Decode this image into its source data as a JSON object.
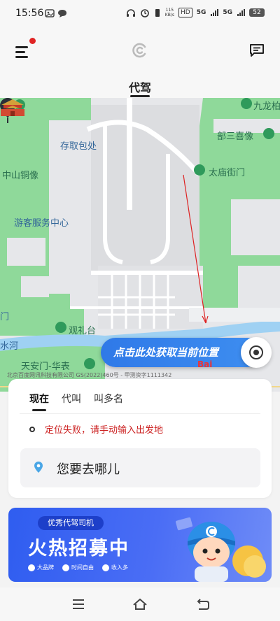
{
  "status_bar": {
    "time": "15:56",
    "net_speed_value": "115",
    "net_speed_unit": "KB/s",
    "hd_label": "HD",
    "signal1": "5G",
    "signal2": "5G",
    "battery": "52"
  },
  "header": {
    "tab_title": "代驾",
    "has_notification": true
  },
  "map": {
    "labels": [
      "九龙柏",
      "存取包处",
      "部三喜像",
      "太庙街门",
      "中山铜像",
      "游客服务中心",
      "观礼台",
      "天安门-华表",
      "门",
      "水河"
    ],
    "locate_banner": "点击此处获取当前位置",
    "copyright": "北京百度网讯科技有限公司 GS(2022)460号 - 甲测资字1111342",
    "brand": "Bai"
  },
  "card": {
    "tabs": [
      "现在",
      "代叫",
      "叫多名"
    ],
    "active_tab": 0,
    "location_error": "定位失败，请手动输入出发地",
    "destination_placeholder": "您要去哪儿"
  },
  "promo": {
    "badge": "优秀代驾司机",
    "title": "火热招募中",
    "tags": [
      "大品牌",
      "时间自由",
      "收入多"
    ]
  },
  "colors": {
    "accent_blue": "#2f79e8",
    "error_red": "#cc2222",
    "park_green": "#8fd99a",
    "water_blue": "#9fd1f3"
  }
}
